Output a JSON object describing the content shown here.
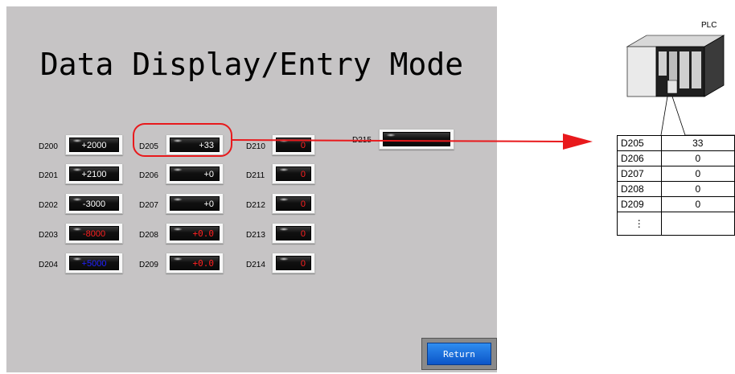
{
  "title": "Data Display/Entry Mode",
  "cells": [
    {
      "label": "D200",
      "value": "+2000",
      "color": "#ffffff",
      "align": "c"
    },
    {
      "label": "D201",
      "value": "+2100",
      "color": "#ffffff",
      "align": "c"
    },
    {
      "label": "D202",
      "value": "-3000",
      "color": "#ffffff",
      "align": "c"
    },
    {
      "label": "D203",
      "value": "-8000",
      "color": "#ff2020",
      "align": "c"
    },
    {
      "label": "D204",
      "value": "+5000",
      "color": "#2020ff",
      "align": "c"
    },
    {
      "label": "D205",
      "value": "+33",
      "color": "#ffffff",
      "align": "r"
    },
    {
      "label": "D206",
      "value": "+0",
      "color": "#ffffff",
      "align": "r"
    },
    {
      "label": "D207",
      "value": "+0",
      "color": "#ffffff",
      "align": "r"
    },
    {
      "label": "D208",
      "value": "+0.0",
      "color": "#ff2020",
      "align": "r"
    },
    {
      "label": "D209",
      "value": "+0.0",
      "color": "#ff2020",
      "align": "r"
    },
    {
      "label": "D210",
      "value": "0",
      "color": "#ff2020",
      "align": "r"
    },
    {
      "label": "D211",
      "value": "0",
      "color": "#ff2020",
      "align": "r"
    },
    {
      "label": "D212",
      "value": "0",
      "color": "#ff2020",
      "align": "r"
    },
    {
      "label": "D213",
      "value": "0",
      "color": "#ff2020",
      "align": "r"
    },
    {
      "label": "D214",
      "value": "0",
      "color": "#ff2020",
      "align": "r"
    },
    {
      "label": "D215",
      "value": "",
      "color": "#ffffff",
      "align": "r"
    }
  ],
  "return_label": "Return",
  "plc": {
    "label": "PLC",
    "rows": [
      {
        "reg": "D205",
        "val": "33"
      },
      {
        "reg": "D206",
        "val": "0"
      },
      {
        "reg": "D207",
        "val": "0"
      },
      {
        "reg": "D208",
        "val": "0"
      },
      {
        "reg": "D209",
        "val": "0"
      },
      {
        "reg": "⋮",
        "val": ""
      }
    ]
  },
  "colors": {
    "panel": "#c6c4c5",
    "highlight": "#e8191c",
    "button": "#1a6fe0"
  }
}
